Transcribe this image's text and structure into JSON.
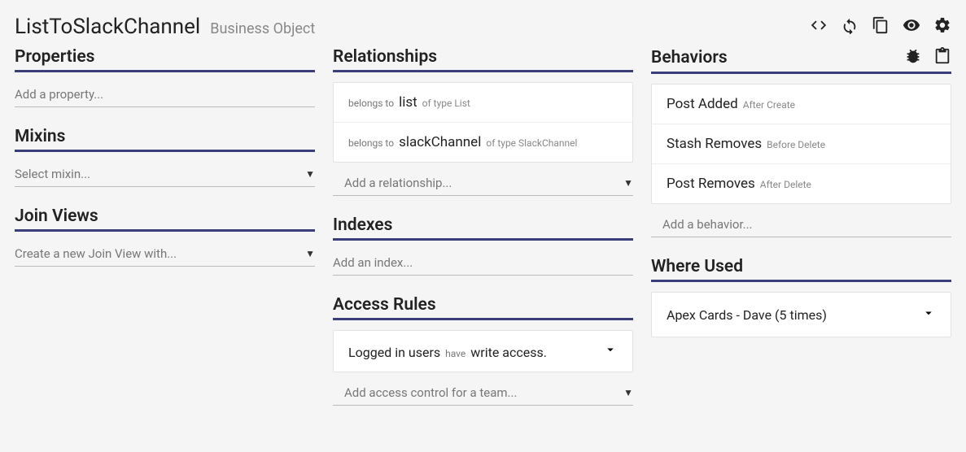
{
  "header": {
    "title": "ListToSlackChannel",
    "subtitle": "Business Object"
  },
  "sections": {
    "properties": {
      "title": "Properties",
      "add_placeholder": "Add a property..."
    },
    "relationships": {
      "title": "Relationships",
      "items": [
        {
          "prefix": "belongs to",
          "name": "list",
          "type_label": "of type List"
        },
        {
          "prefix": "belongs to",
          "name": "slackChannel",
          "type_label": "of type SlackChannel"
        }
      ],
      "add_placeholder": "Add a relationship..."
    },
    "behaviors": {
      "title": "Behaviors",
      "items": [
        {
          "name": "Post Added",
          "trigger": "After Create"
        },
        {
          "name": "Stash Removes",
          "trigger": "Before Delete"
        },
        {
          "name": "Post Removes",
          "trigger": "After Delete"
        }
      ],
      "add_placeholder": "Add a behavior..."
    },
    "mixins": {
      "title": "Mixins",
      "add_placeholder": "Select mixin..."
    },
    "indexes": {
      "title": "Indexes",
      "add_placeholder": "Add an index..."
    },
    "where_used": {
      "title": "Where Used",
      "items": [
        {
          "label": "Apex Cards - Dave (5 times)"
        }
      ]
    },
    "join_views": {
      "title": "Join Views",
      "add_placeholder": "Create a new Join View with..."
    },
    "access_rules": {
      "title": "Access Rules",
      "items": [
        {
          "subject": "Logged in users",
          "verb": "have",
          "predicate": "write access."
        }
      ],
      "add_placeholder": "Add access control for a team..."
    }
  }
}
